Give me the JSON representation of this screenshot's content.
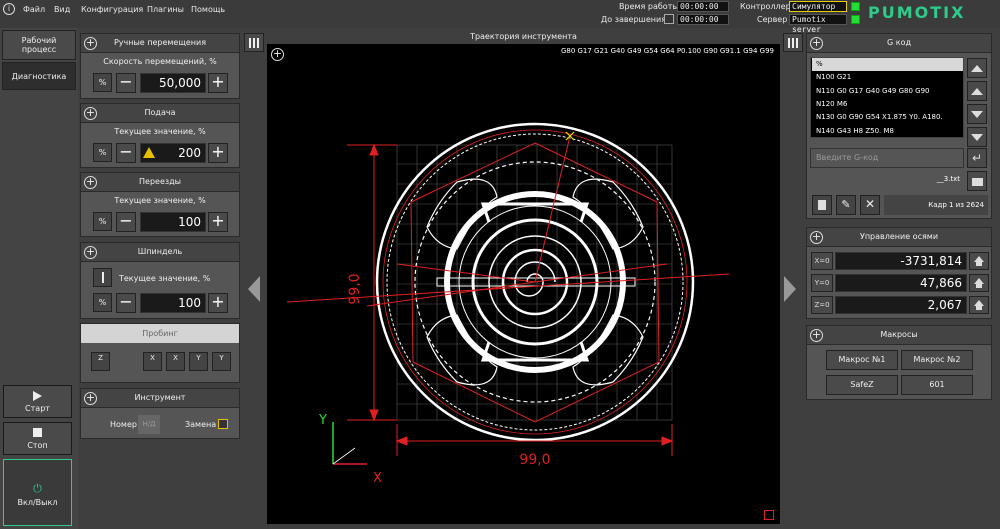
{
  "menu": {
    "file": "Файл",
    "view": "Вид",
    "config": "Конфигурация",
    "plugins": "Плагины",
    "help": "Помощь"
  },
  "status": {
    "work_time_label": "Время работы",
    "work_time": "00:00:00",
    "remaining_label": "До завершения",
    "remaining": "00:00:00",
    "controller_label": "Контроллер",
    "controller": "Симулятор",
    "server_label": "Сервер",
    "server": "Pumotix server",
    "brand": "PUMOTIX"
  },
  "nav": {
    "workflow_line1": "Рабочий",
    "workflow_line2": "процесс",
    "diagnostics": "Диагностика"
  },
  "controls": {
    "start": "Старт",
    "stop": "Стоп",
    "power": "Вкл/Выкл"
  },
  "manual": {
    "title": "Ручные перемещения",
    "label": "Скорость перемещений, %",
    "pct": "%",
    "value": "50,000"
  },
  "feed": {
    "title": "Подача",
    "label": "Текущее значение, %",
    "pct": "%",
    "value": "200"
  },
  "rapid": {
    "title": "Переезды",
    "label": "Текущее значение, %",
    "pct": "%",
    "value": "100"
  },
  "spindle": {
    "title": "Шпиндель",
    "label": "Текущее значение, %",
    "pct": "%",
    "value": "100"
  },
  "probing": {
    "title": "Пробинг",
    "buttons": [
      "Z",
      "X",
      "X",
      "Y",
      "Y"
    ]
  },
  "tool": {
    "title": "Инструмент",
    "number_label": "Номер",
    "number_value": "Н/Д",
    "change_label": "Замена"
  },
  "viewer": {
    "title": "Траектория инструмента",
    "modal": "G80 G17 G21 G40 G49 G54 G64 P0.100 G90 G91.1 G94 G99",
    "dim_x": "99,0",
    "dim_y": "99,0",
    "axis_x": "X",
    "axis_y": "Y"
  },
  "gcode": {
    "title": "G код",
    "lines": [
      "%",
      "N100 G21",
      "N110 G0 G17 G40 G49 G80 G90",
      "N120 M6",
      "N130 G0 G90 G54 X1.875 Y0. A180.",
      "N140 G43 H8 Z50. M8"
    ],
    "input_placeholder": "Введите G-код",
    "filename": "__3.txt",
    "frame": "Кадр 1 из 2624"
  },
  "axes": {
    "title": "Управление осями",
    "rows": [
      {
        "label": "X=0",
        "value": "-3731,814"
      },
      {
        "label": "Y=0",
        "value": "47,866"
      },
      {
        "label": "Z=0",
        "value": "2,067"
      }
    ]
  },
  "macros": {
    "title": "Макросы",
    "buttons": [
      "Макрос №1",
      "Макрос №2",
      "SafeZ",
      "601"
    ]
  },
  "colors": {
    "accent": "#2ecc8a",
    "path_red": "#e02020",
    "led_green": "#22dd33"
  }
}
